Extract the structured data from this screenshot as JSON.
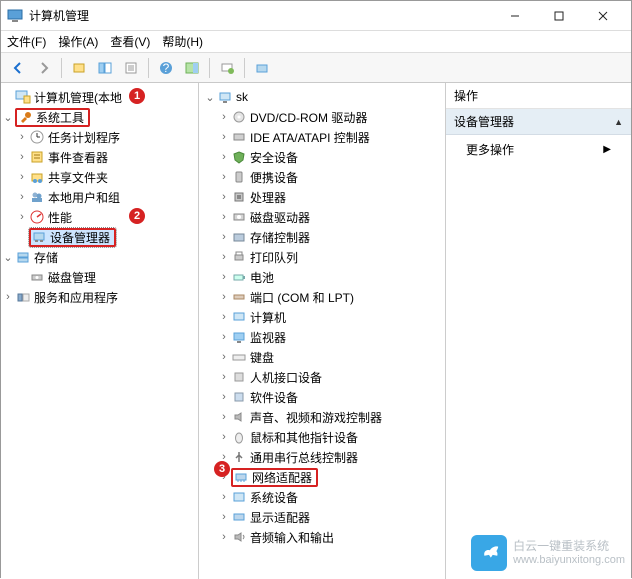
{
  "window": {
    "title": "计算机管理",
    "minimize": "—",
    "maximize": "□",
    "close": "✕"
  },
  "menus": {
    "file": "文件(F)",
    "action": "操作(A)",
    "view": "查看(V)",
    "help": "帮助(H)"
  },
  "left_tree": {
    "root": "计算机管理(本地",
    "sys_tools": "系统工具",
    "task_scheduler": "任务计划程序",
    "event_viewer": "事件查看器",
    "shared_folders": "共享文件夹",
    "local_users": "本地用户和组",
    "performance": "性能",
    "device_manager": "设备管理器",
    "storage": "存储",
    "disk_mgmt": "磁盘管理",
    "services": "服务和应用程序"
  },
  "mid_tree": {
    "root": "sk",
    "dvd": "DVD/CD-ROM 驱动器",
    "ide": "IDE ATA/ATAPI 控制器",
    "security": "安全设备",
    "portable": "便携设备",
    "cpu": "处理器",
    "disk_drives": "磁盘驱动器",
    "storage_ctrl": "存储控制器",
    "print_queues": "打印队列",
    "battery": "电池",
    "ports": "端口 (COM 和 LPT)",
    "computer": "计算机",
    "monitors": "监视器",
    "keyboards": "键盘",
    "hid": "人机接口设备",
    "software_devs": "软件设备",
    "sound": "声音、视频和游戏控制器",
    "mouse": "鼠标和其他指针设备",
    "usb": "通用串行总线控制器",
    "network": "网络适配器",
    "system": "系统设备",
    "display": "显示适配器",
    "audio_io": "音频输入和输出"
  },
  "actions": {
    "header": "操作",
    "section": "设备管理器",
    "more": "更多操作"
  },
  "watermark": {
    "name": "白云一键重装系统",
    "domain": "www.baiyunxitong.com"
  },
  "badges": {
    "b1": "1",
    "b2": "2",
    "b3": "3"
  }
}
